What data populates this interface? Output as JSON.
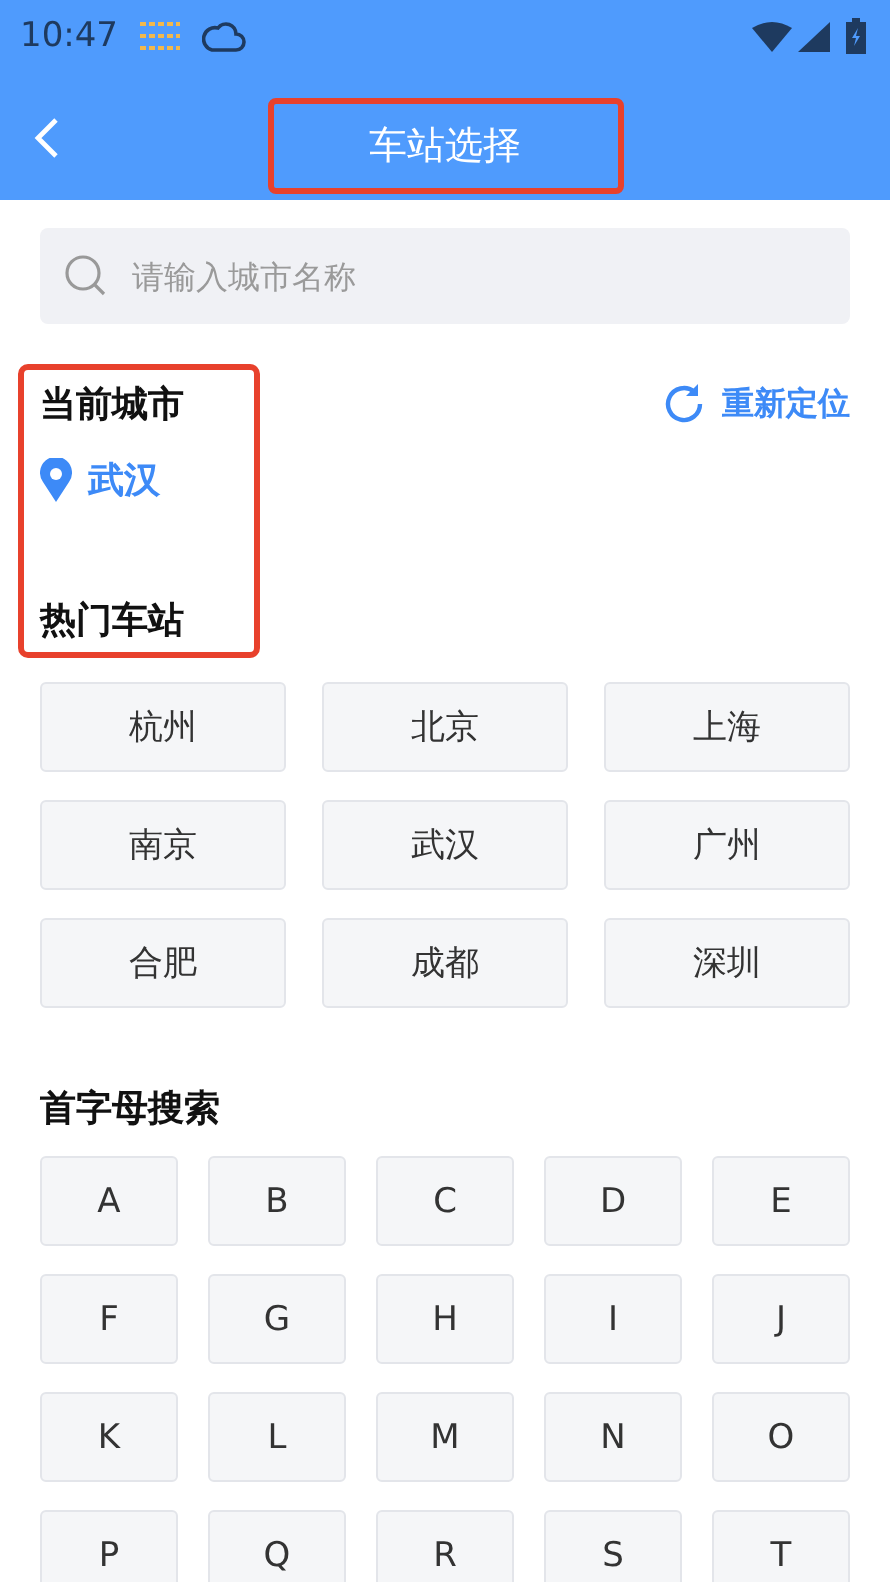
{
  "status_bar": {
    "time": "10:47"
  },
  "header": {
    "title": "车站选择"
  },
  "search": {
    "placeholder": "请输入城市名称"
  },
  "current_city": {
    "heading": "当前城市",
    "city": "武汉",
    "relocate": "重新定位"
  },
  "hot_stations": {
    "heading": "热门车站",
    "items": [
      "杭州",
      "北京",
      "上海",
      "南京",
      "武汉",
      "广州",
      "合肥",
      "成都",
      "深圳"
    ]
  },
  "letter_search": {
    "heading": "首字母搜索",
    "letters": [
      "A",
      "B",
      "C",
      "D",
      "E",
      "F",
      "G",
      "H",
      "I",
      "J",
      "K",
      "L",
      "M",
      "N",
      "O",
      "P",
      "Q",
      "R",
      "S",
      "T"
    ]
  }
}
